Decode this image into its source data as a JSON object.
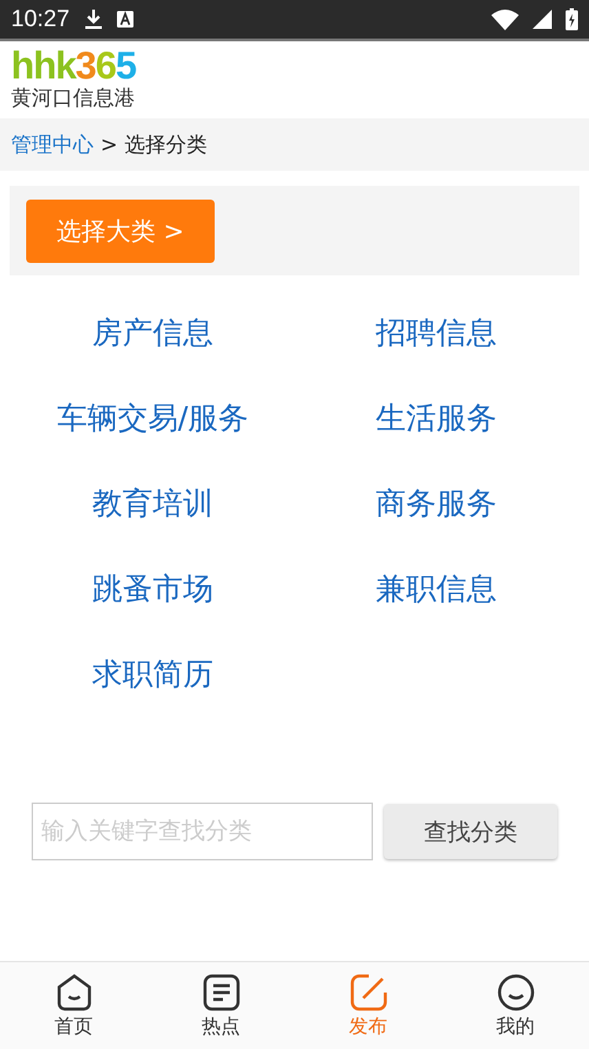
{
  "status_bar": {
    "time": "10:27"
  },
  "logo": {
    "parts": [
      {
        "text": "hhk",
        "color": "#8cc21f"
      },
      {
        "text": "3",
        "color": "#f08a1c"
      },
      {
        "text": "6",
        "color": "#a8c81a"
      },
      {
        "text": "5",
        "color": "#1eb0e8"
      }
    ],
    "subtitle": "黄河口信息港"
  },
  "breadcrumb": {
    "link": "管理中心",
    "separator": ">",
    "current": "选择分类"
  },
  "category_button": "选择大类 >",
  "categories": [
    "房产信息",
    "招聘信息",
    "车辆交易/服务",
    "生活服务",
    "教育培训",
    "商务服务",
    "跳蚤市场",
    "兼职信息",
    "求职简历"
  ],
  "search": {
    "placeholder": "输入关键字查找分类",
    "button": "查找分类"
  },
  "tabs": [
    {
      "label": "首页",
      "kind": "home",
      "selected": false
    },
    {
      "label": "热点",
      "kind": "list",
      "selected": false
    },
    {
      "label": "发布",
      "kind": "edit",
      "selected": true
    },
    {
      "label": "我的",
      "kind": "smile",
      "selected": false
    }
  ]
}
